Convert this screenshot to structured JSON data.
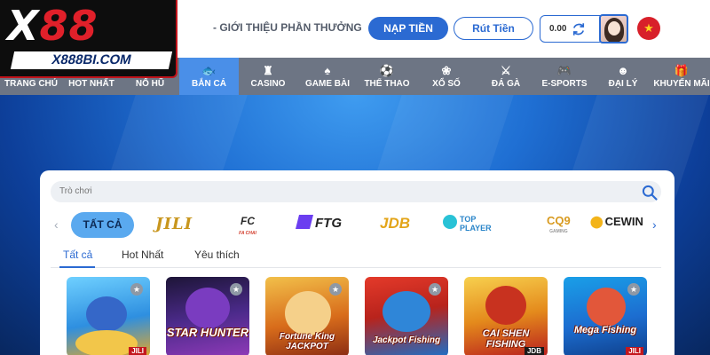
{
  "brand": {
    "logo_text": "X88",
    "logo_sub": "X888BI.COM"
  },
  "header": {
    "intro_link": "- GIỚI THIỆU PHẦN THƯỞNG",
    "deposit_label": "NẠP TIỀN",
    "withdraw_label": "Rút Tiền",
    "balance": "0.00"
  },
  "nav": {
    "items": [
      {
        "label": "TRANG CHỦ",
        "icon": ""
      },
      {
        "label": "HOT NHẤT",
        "icon": ""
      },
      {
        "label": "NỔ HŨ",
        "icon": ""
      },
      {
        "label": "BẮN CÁ",
        "icon": "fish-icon",
        "active": true
      },
      {
        "label": "CASINO",
        "icon": "casino-icon"
      },
      {
        "label": "GAME BÀI",
        "icon": "cards-icon"
      },
      {
        "label": "THỂ THAO",
        "icon": "soccer-ball-icon"
      },
      {
        "label": "XỔ SỐ",
        "icon": "lottery-icon"
      },
      {
        "label": "ĐÁ GÀ",
        "icon": "swords-icon"
      },
      {
        "label": "E-SPORTS",
        "icon": "gamepad-icon"
      },
      {
        "label": "ĐẠI LÝ",
        "icon": "agent-icon"
      },
      {
        "label": "KHUYẾN MÃI",
        "icon": "gift-icon"
      }
    ]
  },
  "panel": {
    "search_placeholder": "Trò chơi",
    "providers": {
      "all": "TẤT CẢ",
      "jili": "JILI",
      "fc": "FC",
      "fc_sub": "FA CHAI",
      "ftg": "FTG",
      "jdb": "JDB",
      "top_player_1": "TOP",
      "top_player_2": "PLAYER",
      "cq9": "CQ9",
      "cq9_sub": "GAMING",
      "cewin": "CEWIN"
    },
    "tabs": [
      "Tất cả",
      "Hot Nhất",
      "Yêu thích"
    ],
    "games": [
      {
        "title": "",
        "badge": "JILI"
      },
      {
        "title": "STAR HUNTER",
        "badge": ""
      },
      {
        "title": "Fortune King JACKPOT",
        "badge": ""
      },
      {
        "title": "Jackpot Fishing",
        "badge": ""
      },
      {
        "title": "CAI SHEN FISHING",
        "badge": "JDB"
      },
      {
        "title": "Mega Fishing",
        "badge": "JILI"
      }
    ]
  },
  "colors": {
    "primary": "#2b6ad2",
    "nav_bg": "#6d7584",
    "nav_active": "#4a8fe8",
    "logo_red": "#e0202a"
  }
}
